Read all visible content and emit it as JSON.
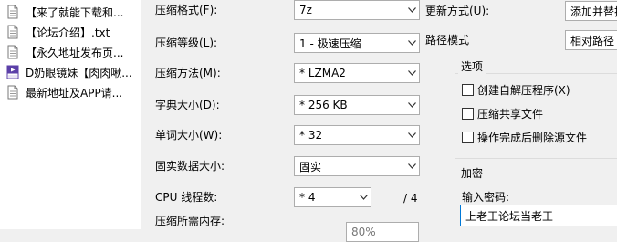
{
  "file_list": [
    {
      "name": "【来了就能下载和...",
      "icon": "text-file-icon"
    },
    {
      "name": "【论坛介绍】.txt",
      "icon": "text-file-icon"
    },
    {
      "name": "【永久地址发布页...",
      "icon": "text-file-icon"
    },
    {
      "name": "D奶眼镜妹【肉肉啾...",
      "icon": "mp4-video-file-icon"
    },
    {
      "name": "最新地址及APP请...",
      "icon": "text-file-icon"
    }
  ],
  "settings": {
    "archive_format": {
      "label": "压缩格式(F):",
      "value": "7z"
    },
    "compression_level": {
      "label": "压缩等级(L):",
      "value": "1 - 极速压缩"
    },
    "compression_method": {
      "label": "压缩方法(M):",
      "value": "* LZMA2"
    },
    "dictionary_size": {
      "label": "字典大小(D):",
      "value": "* 256 KB"
    },
    "word_size": {
      "label": "单词大小(W):",
      "value": "* 32"
    },
    "solid_block_size": {
      "label": "固实数据大小:",
      "value": "固实"
    },
    "cpu_threads": {
      "label": "CPU 线程数:",
      "value": "* 4",
      "max_text": "/ 4"
    },
    "memory_usage": {
      "label": "压缩所需内存:",
      "value": "80%"
    }
  },
  "update": {
    "update_mode": {
      "label": "更新方式(U):",
      "value": "添加并替换"
    },
    "path_mode": {
      "label": "路径模式",
      "value": "相对路径"
    }
  },
  "options": {
    "title": "选项",
    "items": [
      {
        "label": "创建自解压程序(X)",
        "checked": false
      },
      {
        "label": "压缩共享文件",
        "checked": false
      },
      {
        "label": "操作完成后删除源文件",
        "checked": false
      }
    ]
  },
  "encryption": {
    "title": "加密",
    "password_label": "输入密码:",
    "password_value": "上老王论坛当老王"
  },
  "colors": {
    "focus_border": "#0078d7",
    "pdf_icon_purple": "#5b3fa8"
  }
}
